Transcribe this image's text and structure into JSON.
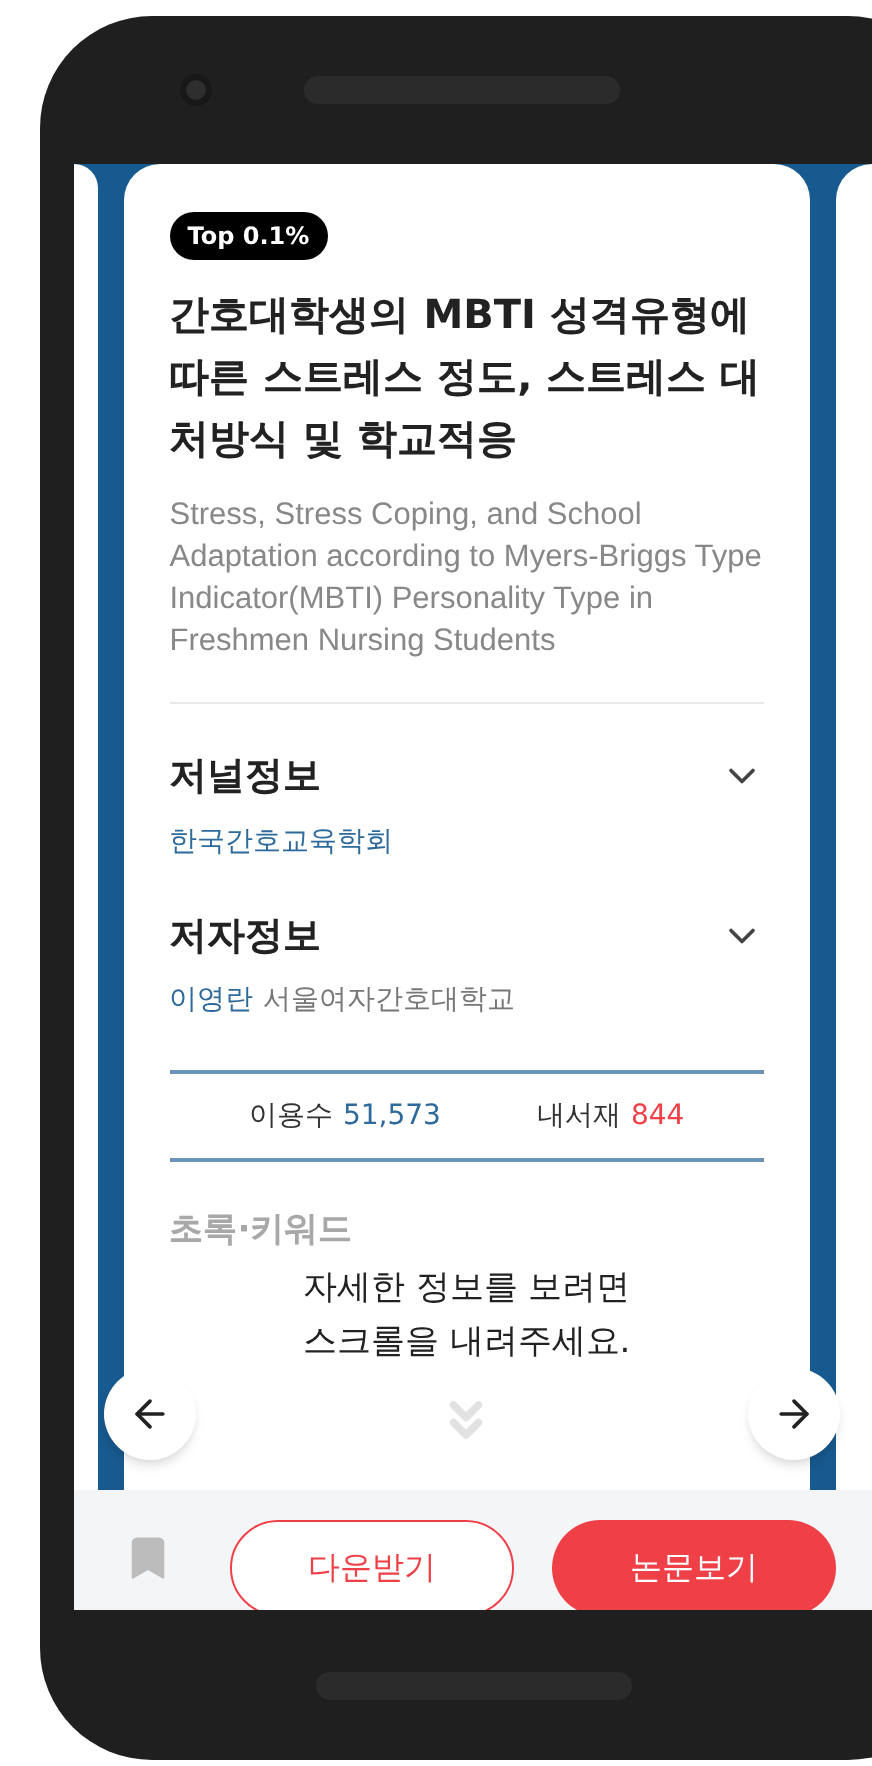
{
  "badge": "Top 0.1%",
  "title": "간호대학생의 MBTI 성격유형에 따른 스트레스 정도, 스트레스 대처방식 및 학교적응",
  "subtitle": "Stress, Stress Coping, and School Adaptation according to Myers-Briggs Type Indicator(MBTI) Personality Type in Freshmen Nursing Students",
  "sections": [
    {
      "kind": "journal",
      "heading": "저널정보",
      "expanded": false,
      "publisher": "한국간호교육학회"
    },
    {
      "kind": "author",
      "heading": "저자정보",
      "expanded": false,
      "author": "이영란",
      "affiliation": "서울여자간호대학교"
    }
  ],
  "stats": [
    {
      "label": "이용수",
      "value": "51,573",
      "kind": "views"
    },
    {
      "label": "내서재",
      "value": "844",
      "kind": "saved"
    }
  ],
  "abstract_heading": "초록·키워드",
  "scroll_hint": [
    "자세한 정보를 보려면",
    "스크롤을 내려주세요."
  ],
  "bottom_bar": {
    "bookmarked": false,
    "download": "다운받기",
    "view": "논문보기"
  }
}
